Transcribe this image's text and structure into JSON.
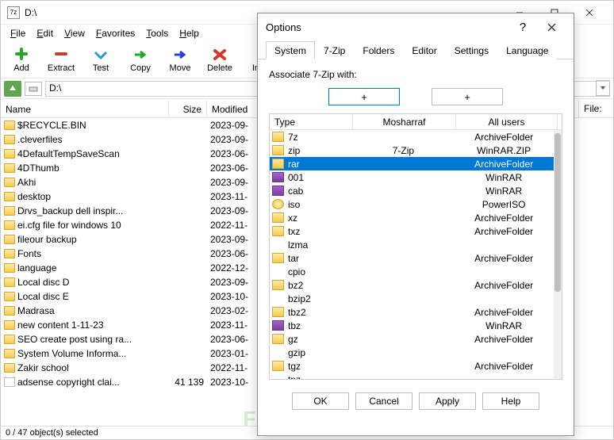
{
  "window": {
    "title": "D:\\",
    "app_icon_text": "7z"
  },
  "menus": [
    "File",
    "Edit",
    "View",
    "Favorites",
    "Tools",
    "Help"
  ],
  "toolbar": [
    {
      "id": "add",
      "label": "Add",
      "color": "#2aa52a"
    },
    {
      "id": "extract",
      "label": "Extract",
      "color": "#c04030"
    },
    {
      "id": "test",
      "label": "Test",
      "color": "#2a9bd6"
    },
    {
      "id": "copy",
      "label": "Copy",
      "color": "#2aa52a"
    },
    {
      "id": "move",
      "label": "Move",
      "color": "#2a3fd6"
    },
    {
      "id": "delete",
      "label": "Delete",
      "color": "#d6372a"
    },
    {
      "id": "info",
      "label": "Info",
      "color": "#e6b82a"
    }
  ],
  "path": "D:\\",
  "columns": {
    "name": "Name",
    "size": "Size",
    "modified": "Modified",
    "file": "File:"
  },
  "files": [
    {
      "name": "$RECYCLE.BIN",
      "size": "",
      "modified": "2023-09-",
      "icon": "folder"
    },
    {
      "name": ".cleverfiles",
      "size": "",
      "modified": "2023-09-",
      "icon": "folder"
    },
    {
      "name": "4DefaultTempSaveScan",
      "size": "",
      "modified": "2023-06-",
      "icon": "folder"
    },
    {
      "name": "4DThumb",
      "size": "",
      "modified": "2023-06-",
      "icon": "folder"
    },
    {
      "name": "Akhi",
      "size": "",
      "modified": "2023-09-",
      "icon": "folder"
    },
    {
      "name": "desktop",
      "size": "",
      "modified": "2023-11-",
      "icon": "folder"
    },
    {
      "name": "Drvs_backup dell inspir...",
      "size": "",
      "modified": "2023-09-",
      "icon": "folder"
    },
    {
      "name": "ei.cfg file for windows 10",
      "size": "",
      "modified": "2022-11-",
      "icon": "folder"
    },
    {
      "name": "fileour backup",
      "size": "",
      "modified": "2023-09-",
      "icon": "folder"
    },
    {
      "name": "Fonts",
      "size": "",
      "modified": "2023-06-",
      "icon": "folder"
    },
    {
      "name": "language",
      "size": "",
      "modified": "2022-12-",
      "icon": "folder"
    },
    {
      "name": "Local disc D",
      "size": "",
      "modified": "2023-09-",
      "icon": "folder"
    },
    {
      "name": "Local disc E",
      "size": "",
      "modified": "2023-10-",
      "icon": "folder"
    },
    {
      "name": "Madrasa",
      "size": "",
      "modified": "2023-02-",
      "icon": "folder"
    },
    {
      "name": "new content 1-11-23",
      "size": "",
      "modified": "2023-11-",
      "icon": "folder"
    },
    {
      "name": "SEO create post using ra...",
      "size": "",
      "modified": "2023-06-",
      "icon": "folder"
    },
    {
      "name": "System Volume Informa...",
      "size": "",
      "modified": "2023-01-",
      "icon": "folder"
    },
    {
      "name": "Zakir school",
      "size": "",
      "modified": "2022-11-",
      "icon": "folder"
    },
    {
      "name": "adsense copyright clai...",
      "size": "41 139",
      "modified": "2023-10-",
      "icon": "file"
    }
  ],
  "statusbar": "0 / 47 object(s) selected",
  "dialog": {
    "title": "Options",
    "tabs": [
      "System",
      "7-Zip",
      "Folders",
      "Editor",
      "Settings",
      "Language"
    ],
    "active_tab": 0,
    "assoc_label": "Associate 7-Zip with:",
    "plus": "+",
    "header": {
      "type": "Type",
      "user": "Mosharraf",
      "all": "All users"
    },
    "rows": [
      {
        "type": "7z",
        "user": "",
        "all": "ArchiveFolder",
        "icon": "arc"
      },
      {
        "type": "zip",
        "user": "7-Zip",
        "all": "WinRAR.ZIP",
        "icon": "arc"
      },
      {
        "type": "rar",
        "user": "",
        "all": "ArchiveFolder",
        "icon": "arc",
        "selected": true
      },
      {
        "type": "001",
        "user": "",
        "all": "WinRAR",
        "icon": "rar"
      },
      {
        "type": "cab",
        "user": "",
        "all": "WinRAR",
        "icon": "rar"
      },
      {
        "type": "iso",
        "user": "",
        "all": "PowerISO",
        "icon": "iso"
      },
      {
        "type": "xz",
        "user": "",
        "all": "ArchiveFolder",
        "icon": "arc"
      },
      {
        "type": "txz",
        "user": "",
        "all": "ArchiveFolder",
        "icon": "arc"
      },
      {
        "type": "lzma",
        "user": "",
        "all": "",
        "icon": "none"
      },
      {
        "type": "tar",
        "user": "",
        "all": "ArchiveFolder",
        "icon": "arc"
      },
      {
        "type": "cpio",
        "user": "",
        "all": "",
        "icon": "none"
      },
      {
        "type": "bz2",
        "user": "",
        "all": "ArchiveFolder",
        "icon": "arc"
      },
      {
        "type": "bzip2",
        "user": "",
        "all": "",
        "icon": "none"
      },
      {
        "type": "tbz2",
        "user": "",
        "all": "ArchiveFolder",
        "icon": "arc"
      },
      {
        "type": "tbz",
        "user": "",
        "all": "WinRAR",
        "icon": "rar"
      },
      {
        "type": "gz",
        "user": "",
        "all": "ArchiveFolder",
        "icon": "arc"
      },
      {
        "type": "gzip",
        "user": "",
        "all": "",
        "icon": "none"
      },
      {
        "type": "tgz",
        "user": "",
        "all": "ArchiveFolder",
        "icon": "arc"
      },
      {
        "type": "tpz",
        "user": "",
        "all": "",
        "icon": "none"
      }
    ],
    "buttons": [
      "OK",
      "Cancel",
      "Apply",
      "Help"
    ]
  },
  "watermark": "FileOur.com"
}
